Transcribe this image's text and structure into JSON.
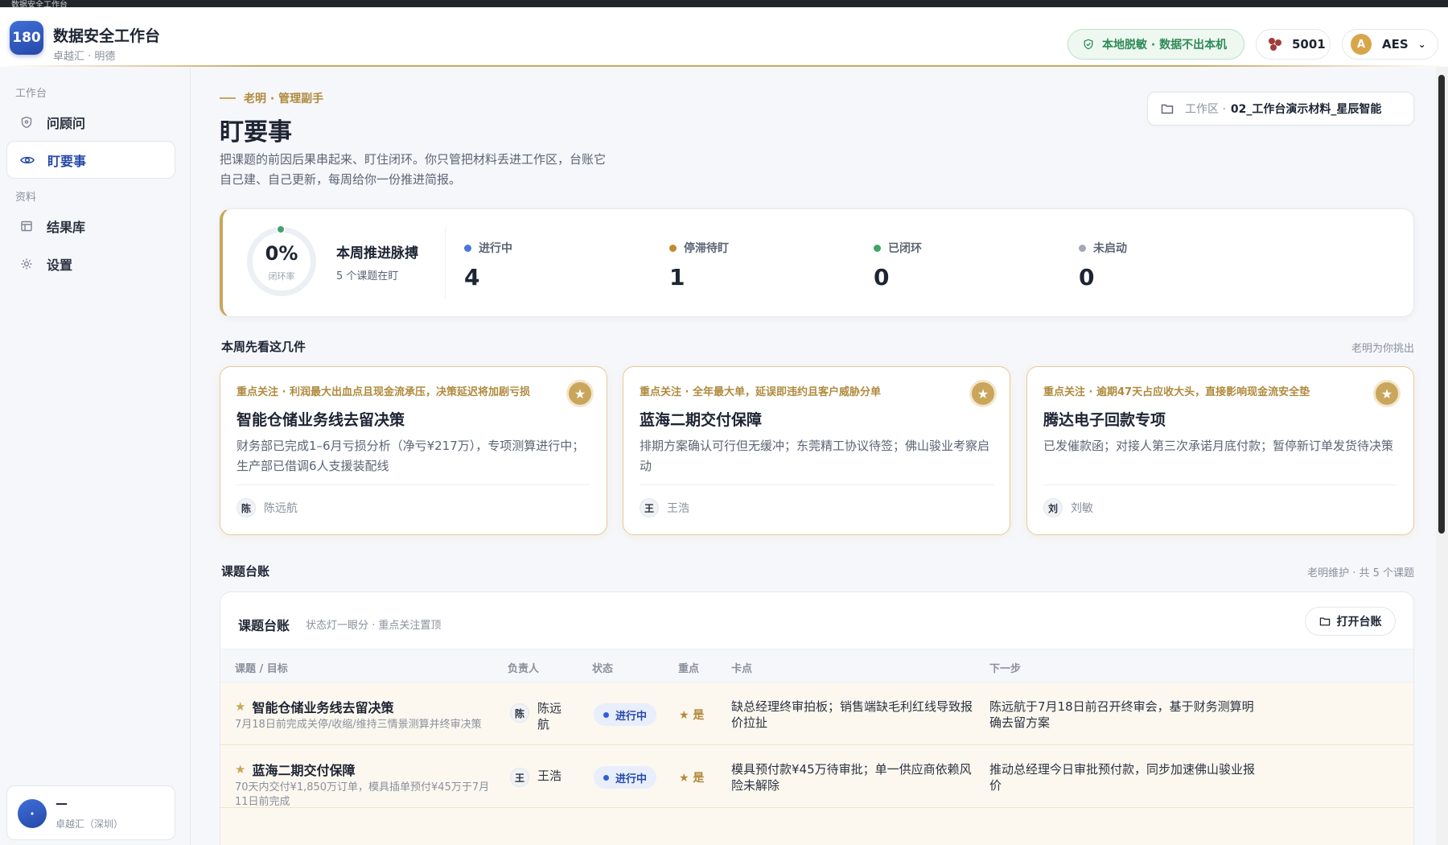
{
  "window": {
    "title": "数据安全工作台"
  },
  "app": {
    "logo": "180",
    "title": "数据安全工作台",
    "subtitle": "卓越汇 · 明德"
  },
  "header": {
    "privacy_badge": "本地脱敏 · 数据不出本机",
    "port": "5001",
    "user_initial": "A",
    "user_name": "AES"
  },
  "sidebar": {
    "group1": "工作台",
    "group2": "资料",
    "items": [
      {
        "label": "问顾问",
        "icon": "shield-icon"
      },
      {
        "label": "盯要事",
        "icon": "eye-icon",
        "active": true
      },
      {
        "label": "结果库",
        "icon": "table-icon"
      },
      {
        "label": "设置",
        "icon": "gear-icon"
      }
    ],
    "footer": {
      "avatar": "•",
      "name": "—",
      "org": "卓越汇（深圳）"
    }
  },
  "page": {
    "eyebrow": "老明 · 管理副手",
    "title": "盯要事",
    "description": "把课题的前因后果串起来、盯住闭环。你只管把材料丢进工作区，台账它自己建、自己更新，每周给你一份推进简报。",
    "workspace_label": "工作区 ·",
    "workspace_value": "02_工作台演示材料_星辰智能"
  },
  "stats": {
    "percent": "0%",
    "percent_label": "闭环率",
    "pulse_title": "本周推进脉搏",
    "pulse_sub": "5 个课题在盯",
    "items": [
      {
        "label": "进行中",
        "value": "4",
        "color": "#4a78d8"
      },
      {
        "label": "停滞待盯",
        "value": "1",
        "color": "#c08a2e"
      },
      {
        "label": "已闭环",
        "value": "0",
        "color": "#3fa46a"
      },
      {
        "label": "未启动",
        "value": "0",
        "color": "#a3a8b2"
      }
    ]
  },
  "focus": {
    "title": "本周先看这几件",
    "right": "老明为你挑出",
    "cards": [
      {
        "tag": "重点关注 · 利润最大出血点且现金流承压，决策延迟将加剧亏损",
        "name": "智能仓储业务线去留决策",
        "desc": "财务部已完成1–6月亏损分析（净亏¥217万），专项测算进行中；生产部已借调6人支援装配线",
        "owner_initial": "陈",
        "owner": "陈远航"
      },
      {
        "tag": "重点关注 · 全年最大单，延误即违约且客户威胁分单",
        "name": "蓝海二期交付保障",
        "desc": "排期方案确认可行但无缓冲；东莞精工协议待签；佛山骏业考察启动",
        "owner_initial": "王",
        "owner": "王浩"
      },
      {
        "tag": "重点关注 · 逾期47天占应收大头，直接影响现金流安全垫",
        "name": "腾达电子回款专项",
        "desc": "已发催款函；对接人第三次承诺月底付款；暂停新订单发货待决策",
        "owner_initial": "刘",
        "owner": "刘敏"
      }
    ]
  },
  "ledger": {
    "section_title": "课题台账",
    "section_right": "老明维护 · 共 5 个课题",
    "title": "课题台账",
    "subtitle": "状态灯一眼分 · 重点关注置顶",
    "open_button": "打开台账",
    "columns": [
      "课题 / 目标",
      "负责人",
      "状态",
      "重点",
      "卡点",
      "下一步"
    ],
    "rows": [
      {
        "name": "智能仓储业务线去留决策",
        "goal": "7月18日前完成关停/收缩/维持三情景测算并终审决策",
        "owner_initial": "陈",
        "owner": "陈远航",
        "status": "进行中",
        "key": "★ 是",
        "block": "缺总经理终审拍板；销售端缺毛利红线导致报价拉扯",
        "next": "陈远航于7月18日前召开终审会，基于财务测算明确去留方案"
      },
      {
        "name": "蓝海二期交付保障",
        "goal": "70天内交付¥1,850万订单，模具插单预付¥45万于7月11日前完成",
        "owner_initial": "王",
        "owner": "王浩",
        "status": "进行中",
        "key": "★ 是",
        "block": "模具预付款¥45万待审批；单一供应商依赖风险未解除",
        "next": "推动总经理今日审批预付款，同步加速佛山骏业报价"
      }
    ]
  }
}
